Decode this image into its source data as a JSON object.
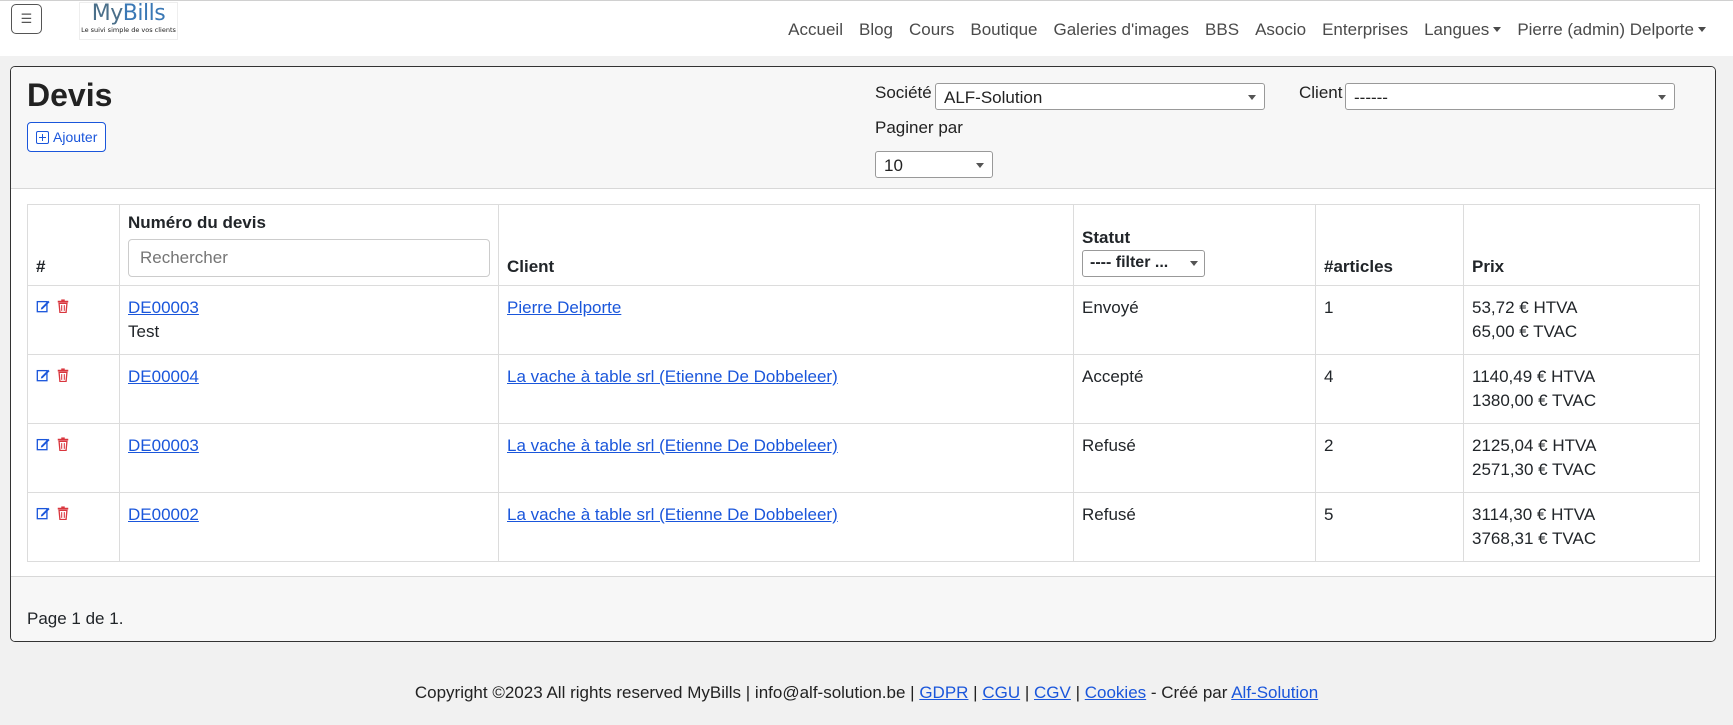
{
  "navbar": {
    "toggler_icon": "hamburger-icon",
    "brand": {
      "name_part1": "My",
      "name_part2": "Bills",
      "tagline": "Le suivi simple de vos clients"
    },
    "links": [
      "Accueil",
      "Blog",
      "Cours",
      "Boutique",
      "Galeries d'images",
      "BBS",
      "Asocio",
      "Enterprises"
    ],
    "languages_label": "Langues",
    "user_label": "Pierre (admin) Delporte"
  },
  "header": {
    "title": "Devis",
    "add_label": "Ajouter",
    "societe_label": "Société",
    "societe_value": "ALF-Solution",
    "client_label": "Client",
    "client_value": "------",
    "paginate_label": "Paginer par",
    "paginate_value": "10"
  },
  "table": {
    "headers": {
      "index": "#",
      "numero": "Numéro du devis",
      "client": "Client",
      "statut": "Statut",
      "articles": "#articles",
      "prix": "Prix"
    },
    "search_placeholder": "Rechercher",
    "filter_label": "---- filter ...",
    "rows": [
      {
        "numero": "DE00003",
        "note": "Test",
        "client": "Pierre Delporte",
        "statut": "Envoyé",
        "articles": "1",
        "htva": "53,72 € HTVA",
        "tvac": "65,00 € TVAC"
      },
      {
        "numero": "DE00004",
        "note": "",
        "client": "La vache à table srl (Etienne De Dobbeleer)",
        "statut": "Accepté",
        "articles": "4",
        "htva": "1140,49 € HTVA",
        "tvac": "1380,00 € TVAC"
      },
      {
        "numero": "DE00003",
        "note": "",
        "client": "La vache à table srl (Etienne De Dobbeleer)",
        "statut": "Refusé",
        "articles": "2",
        "htva": "2125,04 € HTVA",
        "tvac": "2571,30 € TVAC"
      },
      {
        "numero": "DE00002",
        "note": "",
        "client": "La vache à table srl (Etienne De Dobbeleer)",
        "statut": "Refusé",
        "articles": "5",
        "htva": "3114,30 € HTVA",
        "tvac": "3768,31 € TVAC"
      }
    ]
  },
  "pager": {
    "text": "Page 1 de 1."
  },
  "footer": {
    "copyright": "Copyright ©2023 All rights reserved MyBills | info@alf-solution.be |",
    "links": [
      "GDPR",
      "CGU",
      "CGV",
      "Cookies"
    ],
    "sep": "|",
    "created_by": "- Créé par",
    "company": "Alf-Solution"
  },
  "colors": {
    "link": "#1a56db",
    "delete_icon": "#d9363e",
    "edit_icon": "#1a56db"
  }
}
